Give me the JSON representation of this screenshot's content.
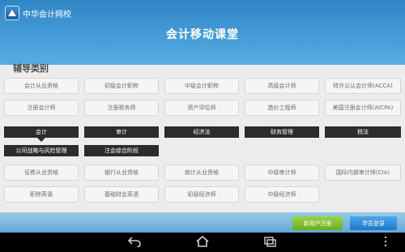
{
  "app": {
    "brand": "中华会计网校",
    "title": "会计移动课堂"
  },
  "section": {
    "title": "辅导类别"
  },
  "categories_top": [
    [
      "会计从业资格",
      "初级会计职称",
      "中级会计职称",
      "高级会计师",
      "特许公认会计师(ACCA)"
    ],
    [
      "注册会计师",
      "注册税务师",
      "资产评估师",
      "造价工程师",
      "美国注册会计师(AICPA)"
    ]
  ],
  "tabs": [
    "会计",
    "审计",
    "经济法",
    "财务管理",
    "税法",
    "公司战略与风险管理",
    "注会综合阶段"
  ],
  "categories_bottom": [
    [
      "证券从业资格",
      "银行从业资格",
      "统计从业资格",
      "中级审计师",
      "国际内部审计师(CIA)"
    ],
    [
      "职称英语",
      "基础财会英语",
      "初级经济师",
      "中级经济师"
    ]
  ],
  "actions": {
    "register": "新用户注册",
    "login": "学员登录"
  },
  "navbar": {
    "back_icon": "back-icon",
    "home_icon": "home-icon",
    "recent_icon": "recent-apps-icon",
    "menu_icon": "menu-icon"
  }
}
